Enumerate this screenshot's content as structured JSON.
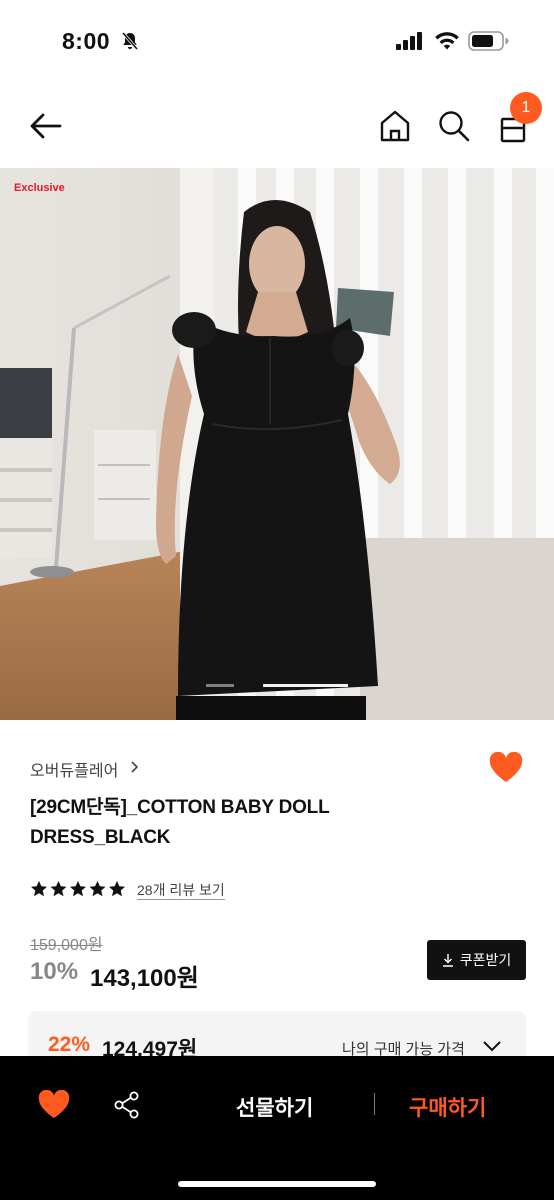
{
  "status_bar": {
    "time": "8:00"
  },
  "nav": {
    "cart_count": "1"
  },
  "hero": {
    "exclusive_label": "Exclusive",
    "slide_index": 2,
    "slide_count": 2
  },
  "product": {
    "brand": "오버듀플레어",
    "title": "[29CM단독]_COTTON BABY DOLL DRESS_BLACK",
    "rating": 5,
    "review_link": "28개 리뷰 보기",
    "original_price": "159,000원",
    "discount_rate": "10%",
    "sale_price": "143,100원",
    "coupon_button": "쿠폰받기"
  },
  "my_price": {
    "discount_rate": "22%",
    "price": "124,497원",
    "label": "나의 구매 가능 가격"
  },
  "bottom_bar": {
    "gift_label": "선물하기",
    "buy_label": "구매하기"
  },
  "colors": {
    "accent": "#ff5a1f",
    "exclusive": "#e11b22",
    "bottom_bar_bg": "#000000"
  }
}
